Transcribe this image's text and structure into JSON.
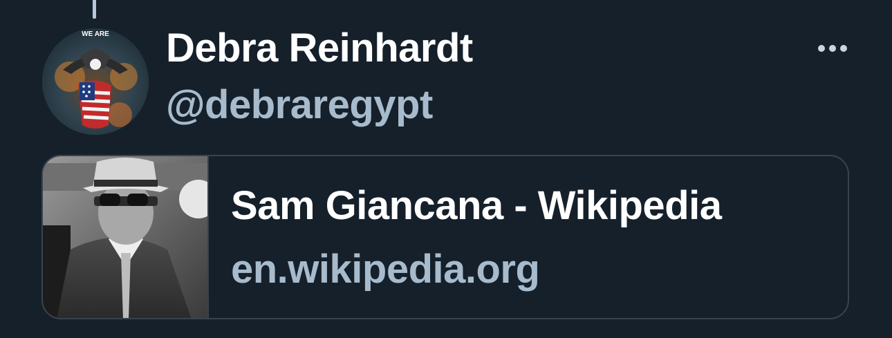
{
  "tweet": {
    "display_name": "Debra Reinhardt",
    "handle": "@debraregypt",
    "avatar_text": "WE ARE"
  },
  "card": {
    "title": "Sam Giancana - Wikipedia",
    "domain": "en.wikipedia.org"
  },
  "icons": {
    "more": "more-horizontal-icon"
  },
  "colors": {
    "background": "#15202b",
    "primary_text": "#ffffff",
    "secondary_text": "#a7bbcc",
    "border": "#38444d"
  }
}
